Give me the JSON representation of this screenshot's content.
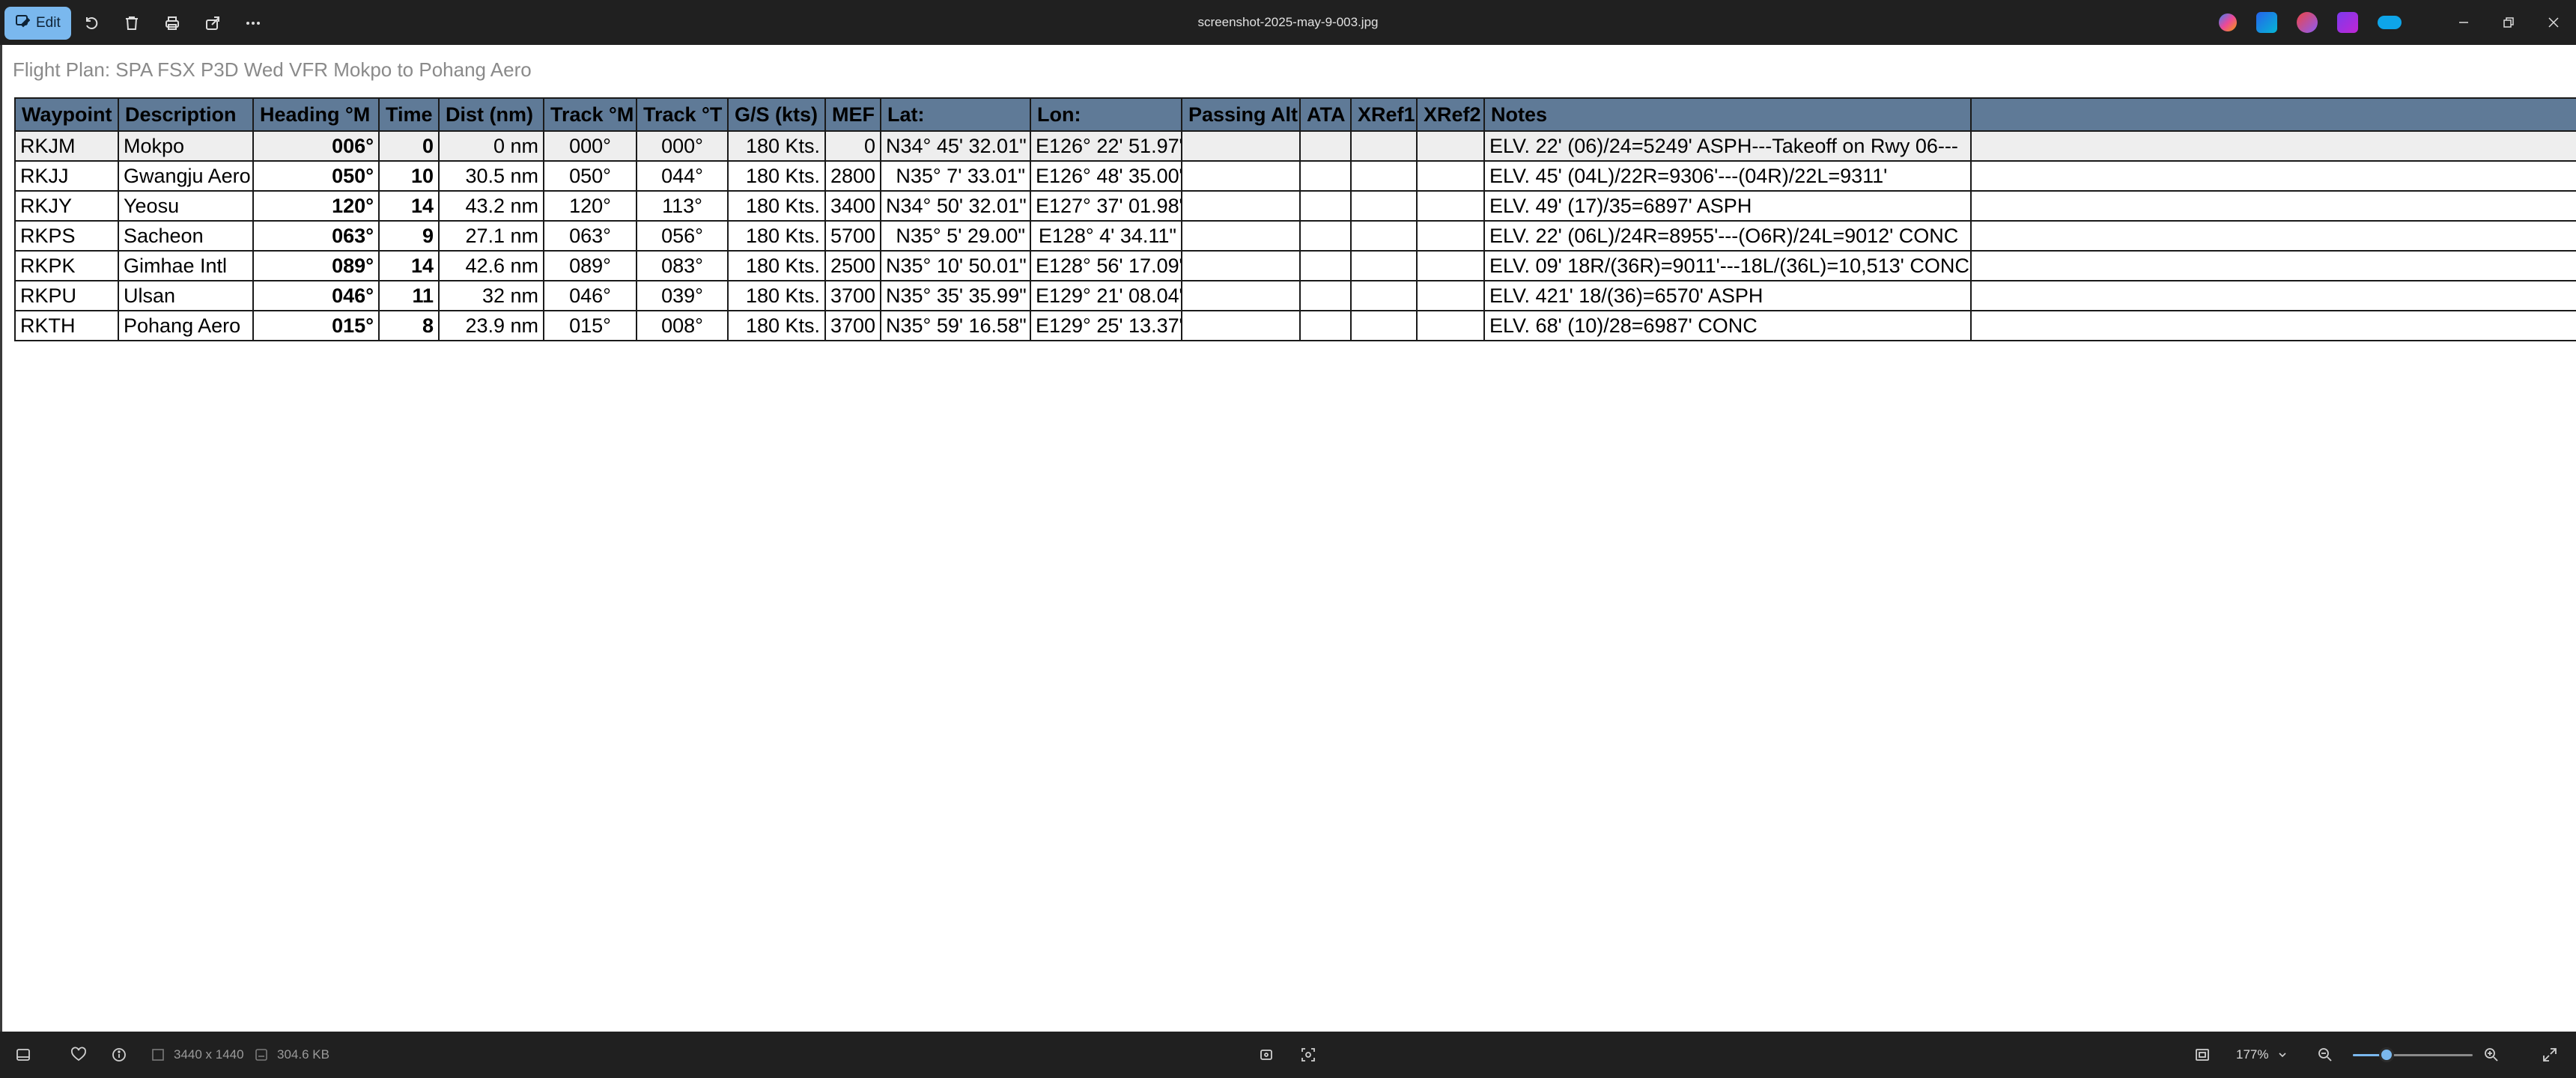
{
  "toolbar": {
    "edit_label": "Edit",
    "title": "screenshot-2025-may-9-003.jpg"
  },
  "document": {
    "title": "Flight Plan: SPA FSX P3D Wed VFR Mokpo to Pohang Aero",
    "columns": [
      "Waypoint",
      "Description",
      "Heading °M",
      "Time",
      "Dist (nm)",
      "Track °M",
      "Track °T",
      "G/S (kts)",
      "MEF",
      "Lat:",
      "Lon:",
      "Passing Alt",
      "ATA",
      "XRef1",
      "XRef2",
      "Notes",
      ""
    ],
    "rows": [
      [
        "RKJM",
        "Mokpo",
        "006°",
        "0",
        "0 nm",
        "000°",
        "000°",
        "180 Kts.",
        "0",
        "N34° 45' 32.01\"",
        "E126° 22' 51.97\"",
        "",
        "",
        "",
        "",
        "ELV. 22'  (06)/24=5249' ASPH---Takeoff on Rwy 06---",
        ""
      ],
      [
        "RKJJ",
        "Gwangju Aero",
        "050°",
        "10",
        "30.5 nm",
        "050°",
        "044°",
        "180 Kts.",
        "2800",
        "N35° 7' 33.01\"",
        "E126° 48' 35.00\"",
        "",
        "",
        "",
        "",
        "ELV. 45'  (04L)/22R=9306'---(04R)/22L=9311'",
        ""
      ],
      [
        "RKJY",
        "Yeosu",
        "120°",
        "14",
        "43.2 nm",
        "120°",
        "113°",
        "180 Kts.",
        "3400",
        "N34° 50' 32.01\"",
        "E127° 37' 01.98\"",
        "",
        "",
        "",
        "",
        "ELV. 49'  (17)/35=6897' ASPH",
        ""
      ],
      [
        "RKPS",
        "Sacheon",
        "063°",
        "9",
        "27.1 nm",
        "063°",
        "056°",
        "180 Kts.",
        "5700",
        "N35° 5' 29.00\"",
        "E128° 4' 34.11\"",
        "",
        "",
        "",
        "",
        "ELV. 22'  (06L)/24R=8955'---(O6R)/24L=9012' CONC",
        ""
      ],
      [
        "RKPK",
        "Gimhae Intl",
        "089°",
        "14",
        "42.6 nm",
        "089°",
        "083°",
        "180 Kts.",
        "2500",
        "N35° 10' 50.01\"",
        "E128° 56' 17.09\"",
        "",
        "",
        "",
        "",
        "ELV. 09'  18R/(36R)=9011'---18L/(36L)=10,513' CONC",
        ""
      ],
      [
        "RKPU",
        "Ulsan",
        "046°",
        "11",
        "32 nm",
        "046°",
        "039°",
        "180 Kts.",
        "3700",
        "N35° 35' 35.99\"",
        "E129° 21' 08.04\"",
        "",
        "",
        "",
        "",
        "ELV. 421'  18/(36)=6570' ASPH",
        ""
      ],
      [
        "RKTH",
        "Pohang Aero",
        "015°",
        "8",
        "23.9 nm",
        "015°",
        "008°",
        "180 Kts.",
        "3700",
        "N35° 59' 16.58\"",
        "E129° 25' 13.37\"",
        "",
        "",
        "",
        "",
        "ELV. 68'  (10)/28=6987' CONC",
        ""
      ]
    ]
  },
  "status": {
    "dimensions": "3440 x 1440",
    "file_size": "304.6 KB",
    "zoom_label": "177%",
    "zoom_fraction": 0.28
  },
  "colors": {
    "header_bg": "#5f7a97",
    "accent": "#7ab8ee",
    "chrome": "#202020"
  }
}
